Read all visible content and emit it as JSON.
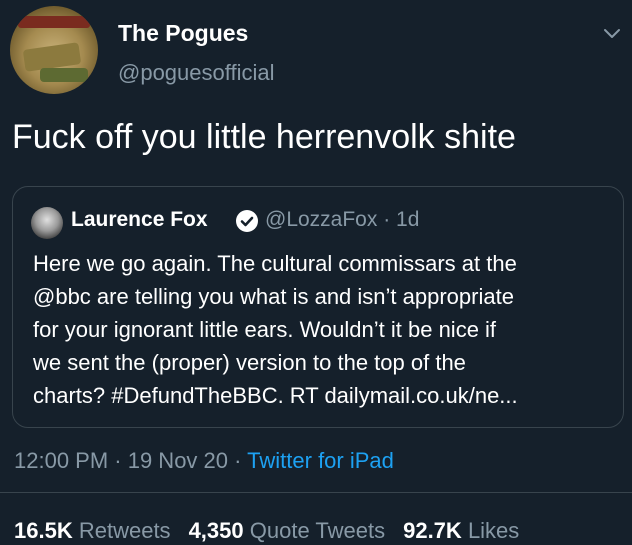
{
  "author": {
    "display_name": "The Pogues",
    "handle": "@poguesofficial"
  },
  "tweet": {
    "text": "Fuck off you little herrenvolk shite"
  },
  "quoted_tweet": {
    "display_name": "Laurence Fox",
    "meta": "@LozzaFox · 1d",
    "lines": [
      "Here we go again. The cultural commissars at the",
      "@bbc are telling you what is and isn’t appropriate",
      "for your ignorant little ears. Wouldn’t it be nice if",
      "we sent the (proper) version to the top of the",
      "charts? #DefundTheBBC. RT dailymail.co.uk/ne..."
    ]
  },
  "timestamp": {
    "time_date": "12:00 PM · 19 Nov 20 · ",
    "source": "Twitter for iPad"
  },
  "stats": {
    "retweets_count": "16.5K",
    "retweets_label": "Retweets",
    "quotes_count": "4,350",
    "quotes_label": "Quote Tweets",
    "likes_count": "92.7K",
    "likes_label": "Likes"
  },
  "colors": {
    "background": "#15202b",
    "secondary_text": "#8899a6",
    "accent": "#1da1f2",
    "border": "#38444d"
  },
  "icons": {
    "menu": "chevron-down-icon",
    "verified": "verified-badge-icon"
  }
}
